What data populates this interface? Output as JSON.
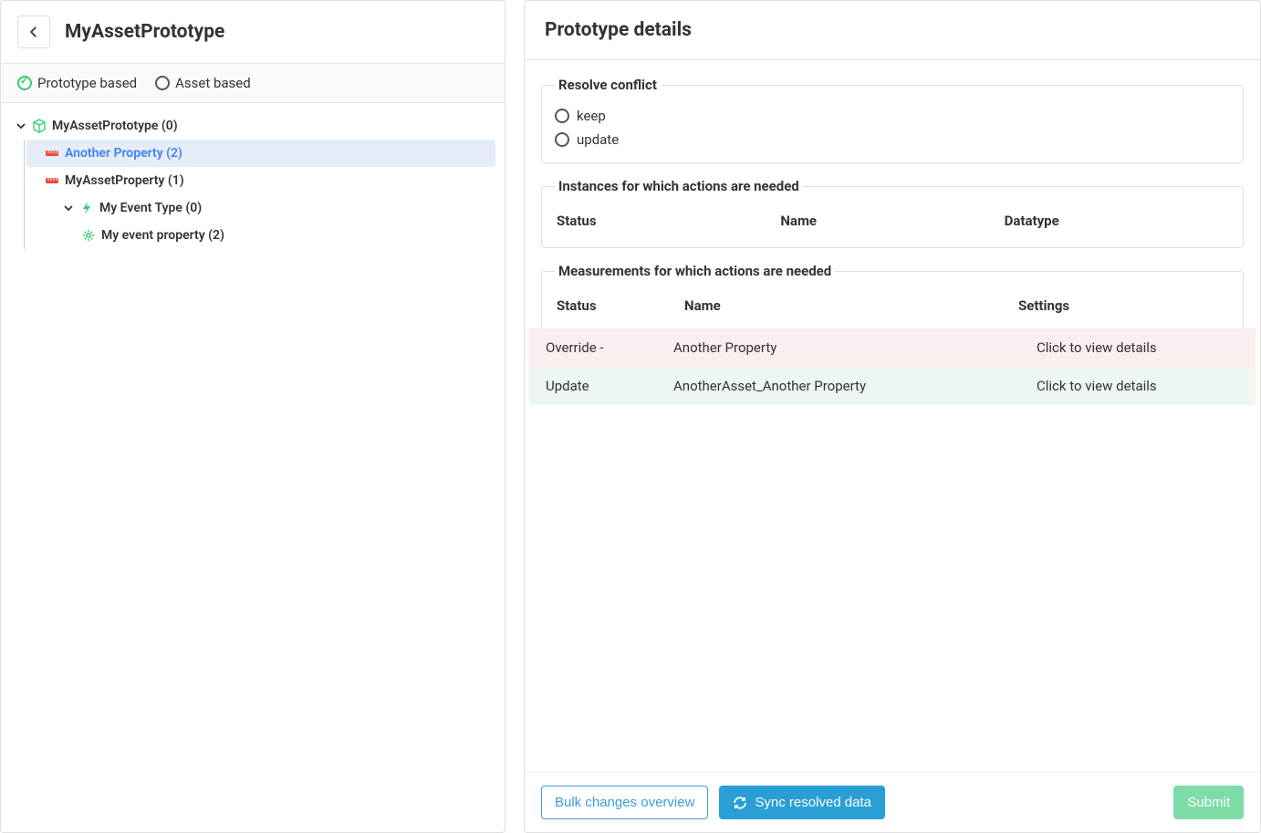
{
  "left": {
    "title": "MyAssetPrototype",
    "tabs": {
      "prototype": "Prototype based",
      "asset": "Asset based"
    },
    "tree": {
      "root": "MyAssetPrototype (0)",
      "anotherProperty": "Another Property (2)",
      "myAssetProperty": "MyAssetProperty (1)",
      "myEventType": "My Event Type (0)",
      "myEventProperty": "My event property (2)"
    }
  },
  "right": {
    "title": "Prototype details",
    "resolve": {
      "legend": "Resolve conflict",
      "keep": "keep",
      "update": "update"
    },
    "instances": {
      "legend": "Instances for which actions are needed",
      "cols": {
        "status": "Status",
        "name": "Name",
        "datatype": "Datatype"
      }
    },
    "measurements": {
      "legend": "Measurements for which actions are needed",
      "cols": {
        "status": "Status",
        "name": "Name",
        "settings": "Settings"
      },
      "rows": [
        {
          "status": "Override -",
          "name": "Another Property",
          "settings": "Click to view details",
          "class": "override"
        },
        {
          "status": "Update",
          "name": "AnotherAsset_Another Property",
          "settings": "Click to view details",
          "class": "update"
        }
      ]
    },
    "footer": {
      "bulk": "Bulk changes overview",
      "sync": "Sync resolved data",
      "submit": "Submit"
    }
  }
}
